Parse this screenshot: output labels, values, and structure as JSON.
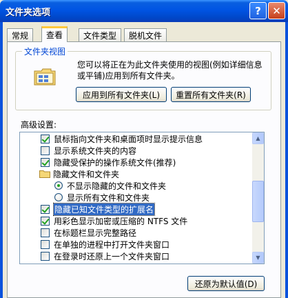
{
  "window": {
    "title": "文件夹选项",
    "help_glyph": "?",
    "close_glyph": "✕"
  },
  "tabs": [
    {
      "label": "常规"
    },
    {
      "label": "查看"
    },
    {
      "label": "文件类型"
    },
    {
      "label": "脱机文件"
    }
  ],
  "folder_view": {
    "legend": "文件夹视图",
    "description": "您可以将正在为此文件夹使用的视图(例如详细信息或平铺)应用到所有文件夹。",
    "apply_label": "应用到所有文件夹(L)",
    "reset_label": "重置所有文件夹(R)"
  },
  "advanced": {
    "label": "高级设置:",
    "items": [
      {
        "type": "checkbox",
        "checked": true,
        "label": "鼠标指向文件夹和桌面项时显示提示信息"
      },
      {
        "type": "checkbox",
        "checked": false,
        "label": "显示系统文件夹的内容"
      },
      {
        "type": "checkbox",
        "checked": true,
        "label": "隐藏受保护的操作系统文件(推荐)"
      },
      {
        "type": "folder",
        "label": "隐藏文件和文件夹"
      },
      {
        "type": "radio",
        "checked": true,
        "label": "不显示隐藏的文件和文件夹"
      },
      {
        "type": "radio",
        "checked": false,
        "label": "显示所有文件和文件夹"
      },
      {
        "type": "checkbox",
        "checked": true,
        "label": "隐藏已知文件类型的扩展名",
        "selected": true
      },
      {
        "type": "checkbox",
        "checked": true,
        "label": "用彩色显示加密或压缩的 NTFS 文件"
      },
      {
        "type": "checkbox",
        "checked": false,
        "label": "在标题栏显示完整路径"
      },
      {
        "type": "checkbox",
        "checked": false,
        "label": "在单独的进程中打开文件夹窗口"
      },
      {
        "type": "checkbox",
        "checked": false,
        "label": "在登录时还原上一个文件夹窗口"
      }
    ],
    "restore_default_label": "还原为默认值(D)"
  },
  "icons": {
    "folder_view_icon": "folder-view-icon",
    "scroll_up": "scroll-up-arrow-icon",
    "scroll_down": "scroll-down-arrow-icon"
  },
  "colors": {
    "title_bar": "#0054e3",
    "accent": "#0046d5",
    "selection": "#316ac5",
    "tab_highlight": "#ffc83c"
  }
}
